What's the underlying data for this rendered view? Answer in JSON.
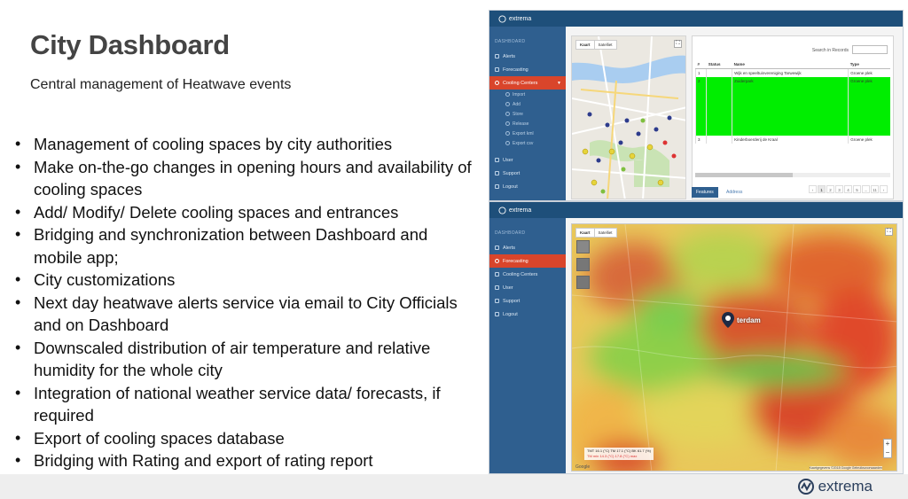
{
  "slide": {
    "title": "City Dashboard",
    "subtitle": "Central management of Heatwave events",
    "bullets": [
      "Management of cooling spaces by city authorities",
      "Make on-the-go changes in opening hours and availability of cooling spaces",
      "Add/ Modify/ Delete cooling spaces and entrances",
      "Bridging and synchronization between Dashboard and mobile app;",
      "City customizations",
      "Next day heatwave alerts service via email to City Officials and on Dashboard",
      "Downscaled distribution of air temperature and relative humidity for the whole city",
      "Integration of national weather service data/ forecasts, if required",
      "Export of cooling spaces database",
      "Bridging with Rating and export of rating report"
    ],
    "footer_logo": "extrema"
  },
  "app_top": {
    "brand": "extrema",
    "sidebar_section": "DASHBOARD",
    "sidebar_items": [
      "Alerts",
      "Forecasting",
      "Cooling Centers",
      "User",
      "Support",
      "Logout"
    ],
    "sidebar_subitems": [
      "Import",
      "Add",
      "Store",
      "Release",
      "Export kml",
      "Export csv"
    ],
    "map_tabs": [
      "Kaart",
      "Satelliet"
    ],
    "search_label": "Search in Records",
    "table": {
      "headers": [
        "#",
        "Status",
        "Name",
        "Type"
      ],
      "rows": [
        [
          "1",
          "",
          "Wijk en speeltuinvereniging Tarwewijk",
          "Groene plek"
        ],
        [
          "2",
          "",
          "Zuiderpark",
          "Groene plek"
        ],
        [
          "3",
          "",
          "Kinderboerderij de Kraal",
          "Groene plek"
        ]
      ]
    },
    "pager": [
      "‹",
      "1",
      "2",
      "3",
      "4",
      "5",
      "...",
      "11",
      "›"
    ],
    "tabs": [
      "Features",
      "Address"
    ],
    "colors": {
      "selected_row": "#00ee00",
      "sidebar": "#2f5f8f",
      "header": "#1e4f7a",
      "active": "#d9452b"
    }
  },
  "app_bottom": {
    "brand": "extrema",
    "sidebar_section": "DASHBOARD",
    "sidebar_items": [
      "Alerts",
      "Forecasting",
      "Cooling Centers",
      "User",
      "Support",
      "Logout"
    ],
    "map_tabs": [
      "Kaart",
      "Satelliet"
    ],
    "city_label": "terdam",
    "legend_line1": "ΤΜΤ 16.1 (°C) ΤΜ 17.1 (°C) ΒΚ 61.7 (%)",
    "legend_line2": "ΤΜ min 14.3 (°C) 17.8 (°C) max",
    "attribution": "Kaartgegevens ©2018 Google  Gebruiksvoorwaarden",
    "google": "Google",
    "zoom": [
      "+",
      "−"
    ]
  }
}
